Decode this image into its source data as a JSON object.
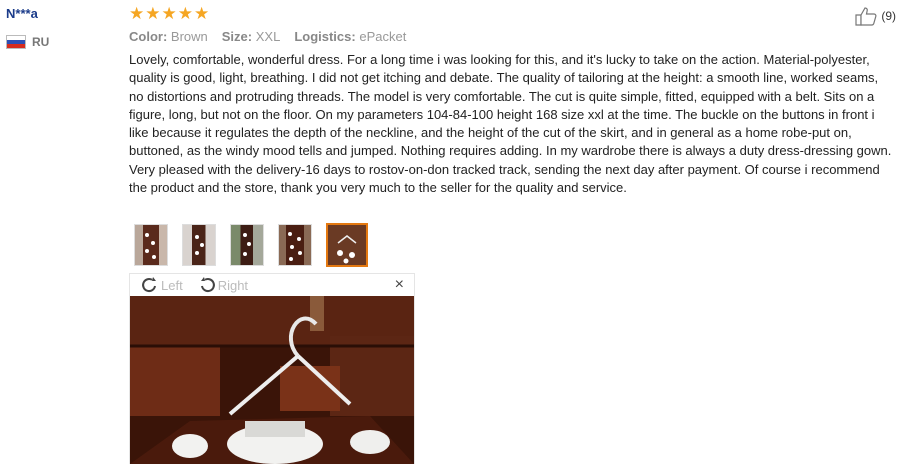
{
  "user": {
    "name": "N***a",
    "country": "RU"
  },
  "rating": {
    "stars": 5
  },
  "helpful": {
    "count": "(9)"
  },
  "meta": {
    "color_label": "Color:",
    "color_value": "Brown",
    "size_label": "Size:",
    "size_value": "XXL",
    "logistics_label": "Logistics:",
    "logistics_value": "ePacket"
  },
  "review_text": "Lovely, comfortable, wonderful dress. For a long time i was looking for this, and it's lucky to take on the action. Material-polyester, quality is good, light, breathing. I did not get itching and debate. The quality of tailoring at the height: a smooth line, worked seams, no distortions and protruding threads. The model is very comfortable. The cut is quite simple, fitted, equipped with a belt. Sits on a figure, long, but not on the floor. On my parameters 104-84-100 height 168 size xxl at the time. The buckle on the buttons in front i like because it regulates the depth of the neckline, and the height of the cut of the skirt, and in general as a home robe-put on, buttoned, as the windy mood tells and jumped. Nothing requires adding. In my wardrobe there is always a duty dress-dressing gown. Very pleased with the delivery-16 days to rostov-on-don tracked track, sending the next day after payment. Of course i recommend the product and the store, thank you very much to the seller for the quality and service.",
  "viewer": {
    "rotate_left": "Left",
    "rotate_right": "Right",
    "close": "×"
  },
  "colors": {
    "star": "#f5a623",
    "accent": "#e47911",
    "username": "#1a3b8a"
  }
}
